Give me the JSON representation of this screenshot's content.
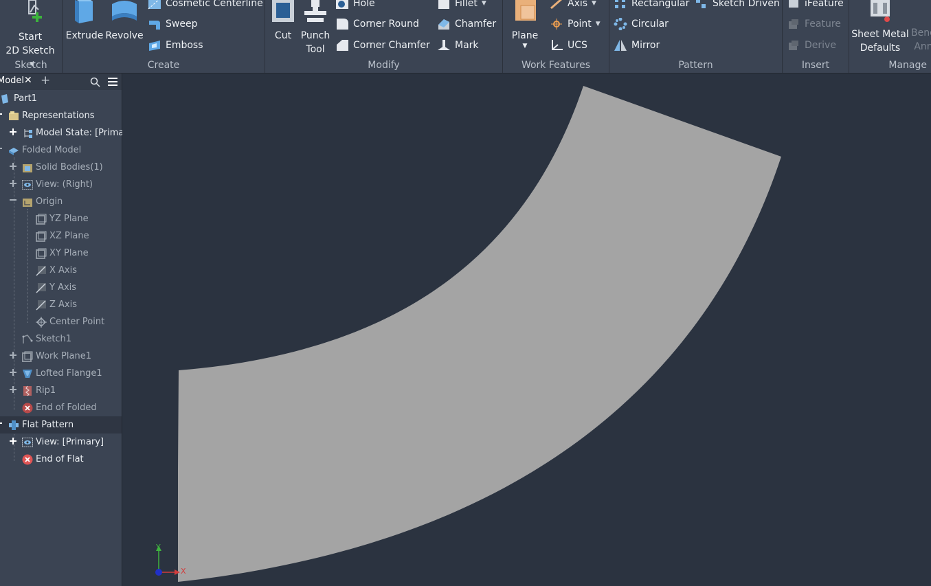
{
  "ribbon": {
    "sketch": {
      "title": "Sketch",
      "start_line1": "Start",
      "start_line2": "2D Sketch"
    },
    "create": {
      "title": "Create",
      "extrude": "Extrude",
      "revolve": "Revolve",
      "cosmetic": "Cosmetic Centerline",
      "sweep": "Sweep",
      "emboss": "Emboss"
    },
    "modify": {
      "title": "Modify",
      "cut": "Cut",
      "punch1": "Punch",
      "punch2": "Tool",
      "hole": "Hole",
      "corner_round": "Corner Round",
      "corner_chamfer": "Corner Chamfer",
      "fillet": "Fillet",
      "chamfer": "Chamfer",
      "mark": "Mark"
    },
    "work": {
      "title": "Work Features",
      "plane": "Plane",
      "axis": "Axis",
      "point": "Point",
      "ucs": "UCS"
    },
    "pattern": {
      "title": "Pattern",
      "rectangular": "Rectangular",
      "sketch_driven": "Sketch Driven",
      "circular": "Circular",
      "mirror": "Mirror"
    },
    "insert": {
      "title": "Insert",
      "ifeature": "iFeature",
      "feature": "Feature",
      "derive": "Derive"
    },
    "manage": {
      "title": "Manage",
      "smd1": "Sheet Metal",
      "smd2": "Defaults",
      "bend1": "Bend",
      "bend2": "Ann"
    }
  },
  "browser": {
    "tab_label": "Model",
    "tree": {
      "part": "Part1",
      "representations": "Representations",
      "model_state": "Model State: [Primary]",
      "folded_model": "Folded Model",
      "solid_bodies": "Solid Bodies(1)",
      "view_right": "View: (Right)",
      "origin": "Origin",
      "yz_plane": "YZ Plane",
      "xz_plane": "XZ Plane",
      "xy_plane": "XY Plane",
      "x_axis": "X Axis",
      "y_axis": "Y Axis",
      "z_axis": "Z Axis",
      "center_point": "Center Point",
      "sketch1": "Sketch1",
      "work_plane1": "Work Plane1",
      "lofted_flange1": "Lofted Flange1",
      "rip1": "Rip1",
      "end_of_folded": "End of Folded",
      "flat_pattern": "Flat Pattern",
      "view_primary": "View: [Primary]",
      "end_of_flat": "End of Flat"
    }
  },
  "viewport": {
    "triad_x": "X",
    "triad_y": "Y",
    "part_color": "#a4a4a4",
    "background": "#2b3340"
  }
}
